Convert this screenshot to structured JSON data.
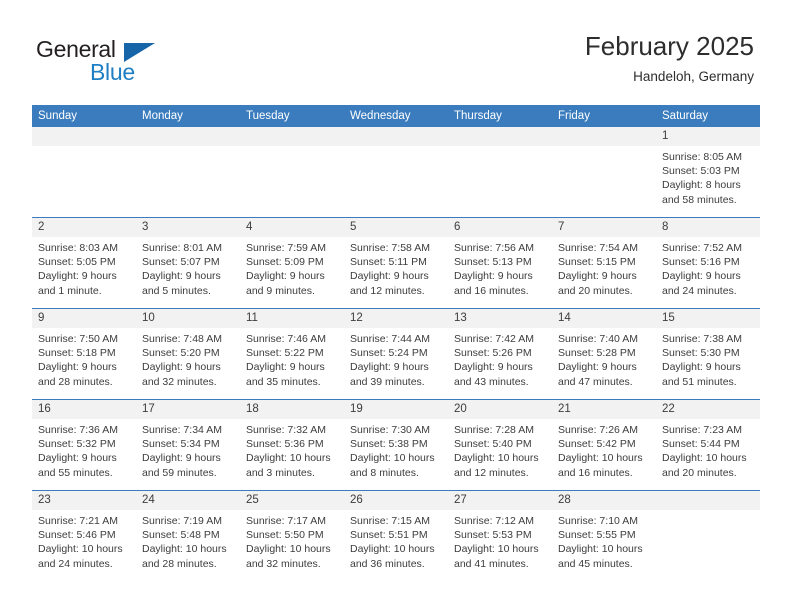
{
  "logo": {
    "word_primary": "General",
    "word_secondary": "Blue",
    "primary_color": "#231f20",
    "secondary_color": "#1f7fc4",
    "triangle_color": "#1565a8"
  },
  "header": {
    "title": "February 2025",
    "subtitle": "Handeloh, Germany"
  },
  "theme": {
    "header_row_bg": "#3a7cbe",
    "daynum_bg": "#f2f2f2",
    "cell_bg": "#ffffff",
    "text_color": "#3d3d3d"
  },
  "calendar": {
    "weekday_headers": [
      "Sunday",
      "Monday",
      "Tuesday",
      "Wednesday",
      "Thursday",
      "Friday",
      "Saturday"
    ],
    "weeks": [
      [
        {
          "day": "",
          "sunrise": "",
          "sunset": "",
          "daylight_line1": "",
          "daylight_line2": "",
          "blank": true
        },
        {
          "day": "",
          "sunrise": "",
          "sunset": "",
          "daylight_line1": "",
          "daylight_line2": "",
          "blank": true
        },
        {
          "day": "",
          "sunrise": "",
          "sunset": "",
          "daylight_line1": "",
          "daylight_line2": "",
          "blank": true
        },
        {
          "day": "",
          "sunrise": "",
          "sunset": "",
          "daylight_line1": "",
          "daylight_line2": "",
          "blank": true
        },
        {
          "day": "",
          "sunrise": "",
          "sunset": "",
          "daylight_line1": "",
          "daylight_line2": "",
          "blank": true
        },
        {
          "day": "",
          "sunrise": "",
          "sunset": "",
          "daylight_line1": "",
          "daylight_line2": "",
          "blank": true
        },
        {
          "day": "1",
          "sunrise": "Sunrise: 8:05 AM",
          "sunset": "Sunset: 5:03 PM",
          "daylight_line1": "Daylight: 8 hours",
          "daylight_line2": "and 58 minutes.",
          "blank": false
        }
      ],
      [
        {
          "day": "2",
          "sunrise": "Sunrise: 8:03 AM",
          "sunset": "Sunset: 5:05 PM",
          "daylight_line1": "Daylight: 9 hours",
          "daylight_line2": "and 1 minute.",
          "blank": false
        },
        {
          "day": "3",
          "sunrise": "Sunrise: 8:01 AM",
          "sunset": "Sunset: 5:07 PM",
          "daylight_line1": "Daylight: 9 hours",
          "daylight_line2": "and 5 minutes.",
          "blank": false
        },
        {
          "day": "4",
          "sunrise": "Sunrise: 7:59 AM",
          "sunset": "Sunset: 5:09 PM",
          "daylight_line1": "Daylight: 9 hours",
          "daylight_line2": "and 9 minutes.",
          "blank": false
        },
        {
          "day": "5",
          "sunrise": "Sunrise: 7:58 AM",
          "sunset": "Sunset: 5:11 PM",
          "daylight_line1": "Daylight: 9 hours",
          "daylight_line2": "and 12 minutes.",
          "blank": false
        },
        {
          "day": "6",
          "sunrise": "Sunrise: 7:56 AM",
          "sunset": "Sunset: 5:13 PM",
          "daylight_line1": "Daylight: 9 hours",
          "daylight_line2": "and 16 minutes.",
          "blank": false
        },
        {
          "day": "7",
          "sunrise": "Sunrise: 7:54 AM",
          "sunset": "Sunset: 5:15 PM",
          "daylight_line1": "Daylight: 9 hours",
          "daylight_line2": "and 20 minutes.",
          "blank": false
        },
        {
          "day": "8",
          "sunrise": "Sunrise: 7:52 AM",
          "sunset": "Sunset: 5:16 PM",
          "daylight_line1": "Daylight: 9 hours",
          "daylight_line2": "and 24 minutes.",
          "blank": false
        }
      ],
      [
        {
          "day": "9",
          "sunrise": "Sunrise: 7:50 AM",
          "sunset": "Sunset: 5:18 PM",
          "daylight_line1": "Daylight: 9 hours",
          "daylight_line2": "and 28 minutes.",
          "blank": false
        },
        {
          "day": "10",
          "sunrise": "Sunrise: 7:48 AM",
          "sunset": "Sunset: 5:20 PM",
          "daylight_line1": "Daylight: 9 hours",
          "daylight_line2": "and 32 minutes.",
          "blank": false
        },
        {
          "day": "11",
          "sunrise": "Sunrise: 7:46 AM",
          "sunset": "Sunset: 5:22 PM",
          "daylight_line1": "Daylight: 9 hours",
          "daylight_line2": "and 35 minutes.",
          "blank": false
        },
        {
          "day": "12",
          "sunrise": "Sunrise: 7:44 AM",
          "sunset": "Sunset: 5:24 PM",
          "daylight_line1": "Daylight: 9 hours",
          "daylight_line2": "and 39 minutes.",
          "blank": false
        },
        {
          "day": "13",
          "sunrise": "Sunrise: 7:42 AM",
          "sunset": "Sunset: 5:26 PM",
          "daylight_line1": "Daylight: 9 hours",
          "daylight_line2": "and 43 minutes.",
          "blank": false
        },
        {
          "day": "14",
          "sunrise": "Sunrise: 7:40 AM",
          "sunset": "Sunset: 5:28 PM",
          "daylight_line1": "Daylight: 9 hours",
          "daylight_line2": "and 47 minutes.",
          "blank": false
        },
        {
          "day": "15",
          "sunrise": "Sunrise: 7:38 AM",
          "sunset": "Sunset: 5:30 PM",
          "daylight_line1": "Daylight: 9 hours",
          "daylight_line2": "and 51 minutes.",
          "blank": false
        }
      ],
      [
        {
          "day": "16",
          "sunrise": "Sunrise: 7:36 AM",
          "sunset": "Sunset: 5:32 PM",
          "daylight_line1": "Daylight: 9 hours",
          "daylight_line2": "and 55 minutes.",
          "blank": false
        },
        {
          "day": "17",
          "sunrise": "Sunrise: 7:34 AM",
          "sunset": "Sunset: 5:34 PM",
          "daylight_line1": "Daylight: 9 hours",
          "daylight_line2": "and 59 minutes.",
          "blank": false
        },
        {
          "day": "18",
          "sunrise": "Sunrise: 7:32 AM",
          "sunset": "Sunset: 5:36 PM",
          "daylight_line1": "Daylight: 10 hours",
          "daylight_line2": "and 3 minutes.",
          "blank": false
        },
        {
          "day": "19",
          "sunrise": "Sunrise: 7:30 AM",
          "sunset": "Sunset: 5:38 PM",
          "daylight_line1": "Daylight: 10 hours",
          "daylight_line2": "and 8 minutes.",
          "blank": false
        },
        {
          "day": "20",
          "sunrise": "Sunrise: 7:28 AM",
          "sunset": "Sunset: 5:40 PM",
          "daylight_line1": "Daylight: 10 hours",
          "daylight_line2": "and 12 minutes.",
          "blank": false
        },
        {
          "day": "21",
          "sunrise": "Sunrise: 7:26 AM",
          "sunset": "Sunset: 5:42 PM",
          "daylight_line1": "Daylight: 10 hours",
          "daylight_line2": "and 16 minutes.",
          "blank": false
        },
        {
          "day": "22",
          "sunrise": "Sunrise: 7:23 AM",
          "sunset": "Sunset: 5:44 PM",
          "daylight_line1": "Daylight: 10 hours",
          "daylight_line2": "and 20 minutes.",
          "blank": false
        }
      ],
      [
        {
          "day": "23",
          "sunrise": "Sunrise: 7:21 AM",
          "sunset": "Sunset: 5:46 PM",
          "daylight_line1": "Daylight: 10 hours",
          "daylight_line2": "and 24 minutes.",
          "blank": false
        },
        {
          "day": "24",
          "sunrise": "Sunrise: 7:19 AM",
          "sunset": "Sunset: 5:48 PM",
          "daylight_line1": "Daylight: 10 hours",
          "daylight_line2": "and 28 minutes.",
          "blank": false
        },
        {
          "day": "25",
          "sunrise": "Sunrise: 7:17 AM",
          "sunset": "Sunset: 5:50 PM",
          "daylight_line1": "Daylight: 10 hours",
          "daylight_line2": "and 32 minutes.",
          "blank": false
        },
        {
          "day": "26",
          "sunrise": "Sunrise: 7:15 AM",
          "sunset": "Sunset: 5:51 PM",
          "daylight_line1": "Daylight: 10 hours",
          "daylight_line2": "and 36 minutes.",
          "blank": false
        },
        {
          "day": "27",
          "sunrise": "Sunrise: 7:12 AM",
          "sunset": "Sunset: 5:53 PM",
          "daylight_line1": "Daylight: 10 hours",
          "daylight_line2": "and 41 minutes.",
          "blank": false
        },
        {
          "day": "28",
          "sunrise": "Sunrise: 7:10 AM",
          "sunset": "Sunset: 5:55 PM",
          "daylight_line1": "Daylight: 10 hours",
          "daylight_line2": "and 45 minutes.",
          "blank": false
        },
        {
          "day": "",
          "sunrise": "",
          "sunset": "",
          "daylight_line1": "",
          "daylight_line2": "",
          "blank": true
        }
      ]
    ]
  }
}
